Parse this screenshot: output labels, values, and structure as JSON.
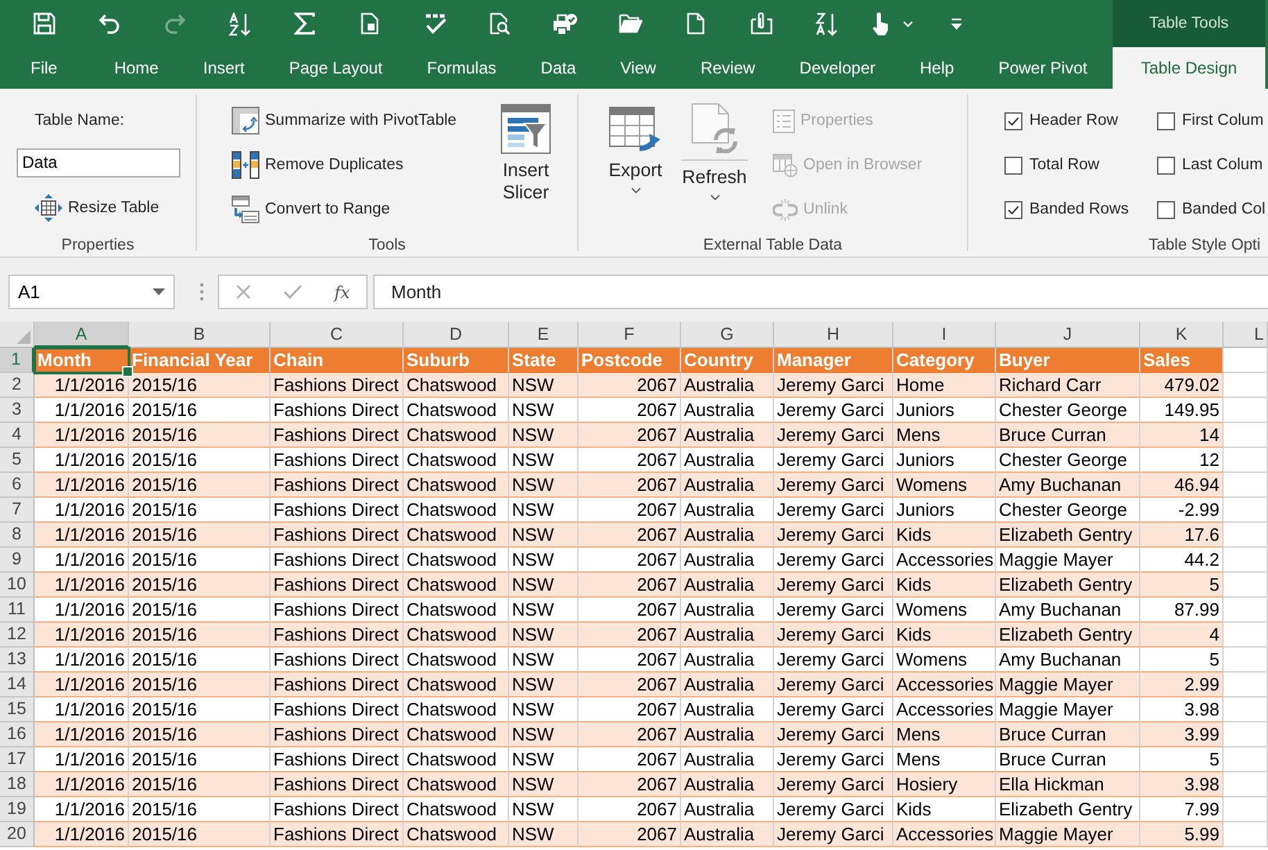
{
  "quick_access": [
    {
      "disabled": false
    },
    {
      "disabled": false
    },
    {
      "disabled": true
    },
    {
      "disabled": false
    },
    {
      "disabled": false
    },
    {
      "disabled": false
    },
    {
      "disabled": false
    },
    {
      "disabled": false
    },
    {
      "disabled": false
    },
    {
      "disabled": false
    },
    {
      "disabled": false
    },
    {
      "disabled": false
    },
    {
      "disabled": false
    },
    {
      "disabled": false
    },
    {
      "disabled": false
    }
  ],
  "contextual_tab_group": {
    "label": "Table Tools"
  },
  "tabs": [
    {
      "label": "File",
      "selected": false
    },
    {
      "label": "Home",
      "selected": false
    },
    {
      "label": "Insert",
      "selected": false
    },
    {
      "label": "Page Layout",
      "selected": false
    },
    {
      "label": "Formulas",
      "selected": false
    },
    {
      "label": "Data",
      "selected": false
    },
    {
      "label": "View",
      "selected": false
    },
    {
      "label": "Review",
      "selected": false
    },
    {
      "label": "Developer",
      "selected": false
    },
    {
      "label": "Help",
      "selected": false
    },
    {
      "label": "Power Pivot",
      "selected": false
    },
    {
      "label": "Table Design",
      "selected": true
    }
  ],
  "ribbon": {
    "properties": {
      "table_name_label": "Table Name:",
      "table_name": "Data",
      "resize_button": "Resize Table",
      "group_label": "Properties"
    },
    "tools": {
      "buttons": [
        "Summarize with PivotTable",
        "Remove Duplicates",
        "Convert to Range"
      ],
      "slicer_button": "Insert Slicer",
      "group_label": "Tools"
    },
    "external_table_data": {
      "export_button": "Export",
      "refresh_button": "Refresh",
      "buttons": [
        {
          "label": "Properties",
          "disabled": true
        },
        {
          "label": "Open in Browser",
          "disabled": true
        },
        {
          "label": "Unlink",
          "disabled": true
        }
      ],
      "group_label": "External Table Data"
    },
    "table_style_options": {
      "options": [
        {
          "label": "Header Row",
          "checked": true
        },
        {
          "label": "Total Row",
          "checked": false
        },
        {
          "label": "Banded Rows",
          "checked": true
        },
        {
          "label": "First Colum",
          "checked": false
        },
        {
          "label": "Last Colum",
          "checked": false
        },
        {
          "label": "Banded Col",
          "checked": false
        }
      ],
      "group_label": "Table Style Opti"
    }
  },
  "formula_bar": {
    "name_box": "A1",
    "function_button": "fx",
    "formula": "Month"
  },
  "sheet": {
    "columns": [
      {
        "letter": "A",
        "selected": true,
        "kind": "number"
      },
      {
        "letter": "B",
        "selected": false,
        "kind": "text"
      },
      {
        "letter": "C",
        "selected": false,
        "kind": "text"
      },
      {
        "letter": "D",
        "selected": false,
        "kind": "text"
      },
      {
        "letter": "E",
        "selected": false,
        "kind": "text"
      },
      {
        "letter": "F",
        "selected": false,
        "kind": "number"
      },
      {
        "letter": "G",
        "selected": false,
        "kind": "text"
      },
      {
        "letter": "H",
        "selected": false,
        "kind": "text"
      },
      {
        "letter": "I",
        "selected": false,
        "kind": "text"
      },
      {
        "letter": "J",
        "selected": false,
        "kind": "text"
      },
      {
        "letter": "K",
        "selected": false,
        "kind": "number"
      },
      {
        "letter": "L",
        "selected": false,
        "kind": "text"
      }
    ],
    "rows": [
      {
        "number": "1",
        "selected": true,
        "cells": [
          "Month",
          "Financial Year",
          "Chain",
          "Suburb",
          "State",
          "Postcode",
          "Country",
          "Manager",
          "Category",
          "Buyer",
          "Sales"
        ]
      },
      {
        "number": "2",
        "selected": false,
        "cells": [
          "1/1/2016",
          "2015/16",
          "Fashions Direct",
          "Chatswood",
          "NSW",
          "2067",
          "Australia",
          "Jeremy Garci",
          "Home",
          "Richard Carr",
          "479.02"
        ]
      },
      {
        "number": "3",
        "selected": false,
        "cells": [
          "1/1/2016",
          "2015/16",
          "Fashions Direct",
          "Chatswood",
          "NSW",
          "2067",
          "Australia",
          "Jeremy Garci",
          "Juniors",
          "Chester George",
          "149.95"
        ]
      },
      {
        "number": "4",
        "selected": false,
        "cells": [
          "1/1/2016",
          "2015/16",
          "Fashions Direct",
          "Chatswood",
          "NSW",
          "2067",
          "Australia",
          "Jeremy Garci",
          "Mens",
          "Bruce Curran",
          "14"
        ]
      },
      {
        "number": "5",
        "selected": false,
        "cells": [
          "1/1/2016",
          "2015/16",
          "Fashions Direct",
          "Chatswood",
          "NSW",
          "2067",
          "Australia",
          "Jeremy Garci",
          "Juniors",
          "Chester George",
          "12"
        ]
      },
      {
        "number": "6",
        "selected": false,
        "cells": [
          "1/1/2016",
          "2015/16",
          "Fashions Direct",
          "Chatswood",
          "NSW",
          "2067",
          "Australia",
          "Jeremy Garci",
          "Womens",
          "Amy Buchanan",
          "46.94"
        ]
      },
      {
        "number": "7",
        "selected": false,
        "cells": [
          "1/1/2016",
          "2015/16",
          "Fashions Direct",
          "Chatswood",
          "NSW",
          "2067",
          "Australia",
          "Jeremy Garci",
          "Juniors",
          "Chester George",
          "-2.99"
        ]
      },
      {
        "number": "8",
        "selected": false,
        "cells": [
          "1/1/2016",
          "2015/16",
          "Fashions Direct",
          "Chatswood",
          "NSW",
          "2067",
          "Australia",
          "Jeremy Garci",
          "Kids",
          "Elizabeth Gentry",
          "17.6"
        ]
      },
      {
        "number": "9",
        "selected": false,
        "cells": [
          "1/1/2016",
          "2015/16",
          "Fashions Direct",
          "Chatswood",
          "NSW",
          "2067",
          "Australia",
          "Jeremy Garci",
          "Accessories",
          "Maggie Mayer",
          "44.2"
        ]
      },
      {
        "number": "10",
        "selected": false,
        "cells": [
          "1/1/2016",
          "2015/16",
          "Fashions Direct",
          "Chatswood",
          "NSW",
          "2067",
          "Australia",
          "Jeremy Garci",
          "Kids",
          "Elizabeth Gentry",
          "5"
        ]
      },
      {
        "number": "11",
        "selected": false,
        "cells": [
          "1/1/2016",
          "2015/16",
          "Fashions Direct",
          "Chatswood",
          "NSW",
          "2067",
          "Australia",
          "Jeremy Garci",
          "Womens",
          "Amy Buchanan",
          "87.99"
        ]
      },
      {
        "number": "12",
        "selected": false,
        "cells": [
          "1/1/2016",
          "2015/16",
          "Fashions Direct",
          "Chatswood",
          "NSW",
          "2067",
          "Australia",
          "Jeremy Garci",
          "Kids",
          "Elizabeth Gentry",
          "4"
        ]
      },
      {
        "number": "13",
        "selected": false,
        "cells": [
          "1/1/2016",
          "2015/16",
          "Fashions Direct",
          "Chatswood",
          "NSW",
          "2067",
          "Australia",
          "Jeremy Garci",
          "Womens",
          "Amy Buchanan",
          "5"
        ]
      },
      {
        "number": "14",
        "selected": false,
        "cells": [
          "1/1/2016",
          "2015/16",
          "Fashions Direct",
          "Chatswood",
          "NSW",
          "2067",
          "Australia",
          "Jeremy Garci",
          "Accessories",
          "Maggie Mayer",
          "2.99"
        ]
      },
      {
        "number": "15",
        "selected": false,
        "cells": [
          "1/1/2016",
          "2015/16",
          "Fashions Direct",
          "Chatswood",
          "NSW",
          "2067",
          "Australia",
          "Jeremy Garci",
          "Accessories",
          "Maggie Mayer",
          "3.98"
        ]
      },
      {
        "number": "16",
        "selected": false,
        "cells": [
          "1/1/2016",
          "2015/16",
          "Fashions Direct",
          "Chatswood",
          "NSW",
          "2067",
          "Australia",
          "Jeremy Garci",
          "Mens",
          "Bruce Curran",
          "3.99"
        ]
      },
      {
        "number": "17",
        "selected": false,
        "cells": [
          "1/1/2016",
          "2015/16",
          "Fashions Direct",
          "Chatswood",
          "NSW",
          "2067",
          "Australia",
          "Jeremy Garci",
          "Mens",
          "Bruce Curran",
          "5"
        ]
      },
      {
        "number": "18",
        "selected": false,
        "cells": [
          "1/1/2016",
          "2015/16",
          "Fashions Direct",
          "Chatswood",
          "NSW",
          "2067",
          "Australia",
          "Jeremy Garci",
          "Hosiery",
          "Ella Hickman",
          "3.98"
        ]
      },
      {
        "number": "19",
        "selected": false,
        "cells": [
          "1/1/2016",
          "2015/16",
          "Fashions Direct",
          "Chatswood",
          "NSW",
          "2067",
          "Australia",
          "Jeremy Garci",
          "Kids",
          "Elizabeth Gentry",
          "7.99"
        ]
      },
      {
        "number": "20",
        "selected": false,
        "cells": [
          "1/1/2016",
          "2015/16",
          "Fashions Direct",
          "Chatswood",
          "NSW",
          "2067",
          "Australia",
          "Jeremy Garci",
          "Accessories",
          "Maggie Mayer",
          "5.99"
        ]
      }
    ]
  }
}
